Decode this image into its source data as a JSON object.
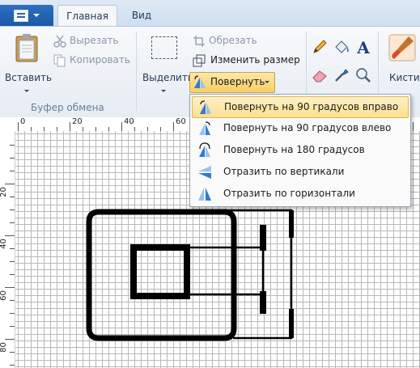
{
  "tabs": {
    "home": "Главная",
    "view": "Вид"
  },
  "clipboard": {
    "paste": "Вставить",
    "cut": "Вырезать",
    "copy": "Копировать",
    "group": "Буфер обмена"
  },
  "image": {
    "select": "Выделить",
    "crop": "Обрезать",
    "resize": "Изменить размер",
    "rotate": "Повернуть"
  },
  "brushes": "Кисти",
  "rotate_menu": {
    "items": [
      "Повернуть на 90 градусов вправо",
      "Повернуть на 90 градусов влево",
      "Повернуть на 180 градусов",
      "Отразить по вертикали",
      "Отразить по горизонтали"
    ]
  },
  "ruler": {
    "top": [
      "0",
      "20",
      "40",
      "60"
    ],
    "left": [
      "20",
      "40",
      "60",
      "80"
    ]
  }
}
